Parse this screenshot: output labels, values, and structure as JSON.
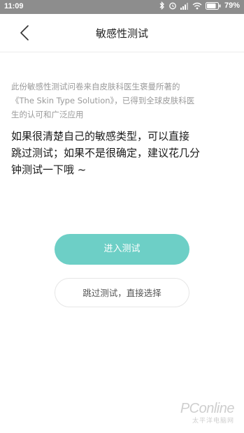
{
  "status_bar": {
    "time": "11:09",
    "battery_percent": "79%",
    "icons": [
      "bluetooth-icon",
      "alarm-icon",
      "signal-icon",
      "wifi-icon",
      "battery-icon"
    ]
  },
  "header": {
    "title": "敏感性测试",
    "back_icon": "chevron-left-icon"
  },
  "description": {
    "lines": [
      "此份敏感性测试问卷来自皮肤科医生褒曼所著的",
      "《The Skin Type Solution》，已得到全球皮肤科医",
      "生的认可和广泛应用"
    ]
  },
  "main_text": {
    "lines": [
      "如果很清楚自己的敏感类型，可以直接",
      "跳过测试；如果不是很确定，建议花几分",
      "钟测试一下哦 ~"
    ]
  },
  "buttons": {
    "start_test": "进入测试",
    "skip_test": "跳过测试，直接选择"
  },
  "watermark": {
    "brand": "PConline",
    "sub": "太平洋电脑网"
  },
  "colors": {
    "status_bar": "#8d8d8d",
    "primary_button": "#6dcfc6",
    "description_text": "#9a9a9a"
  }
}
